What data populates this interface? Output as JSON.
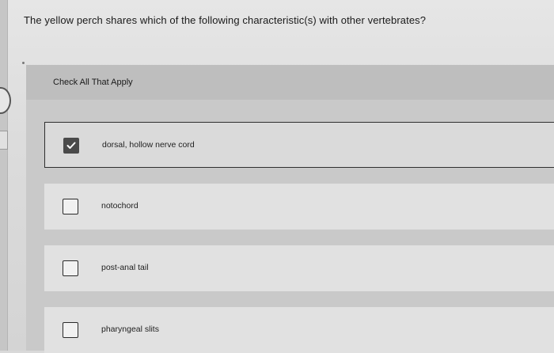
{
  "question": {
    "text": "The yellow perch shares which of the following characteristic(s) with other vertebrates?"
  },
  "instruction": "Check All That Apply",
  "options": [
    {
      "label": "dorsal, hollow nerve cord",
      "checked": true
    },
    {
      "label": "notochord",
      "checked": false
    },
    {
      "label": "post-anal tail",
      "checked": false
    },
    {
      "label": "pharyngeal slits",
      "checked": false
    }
  ],
  "colors": {
    "checked_box": "#4a4a4a",
    "selected_border": "#2f2f2f",
    "panel": "#c9c9c9"
  },
  "icons": {
    "check": "checkmark-icon"
  }
}
